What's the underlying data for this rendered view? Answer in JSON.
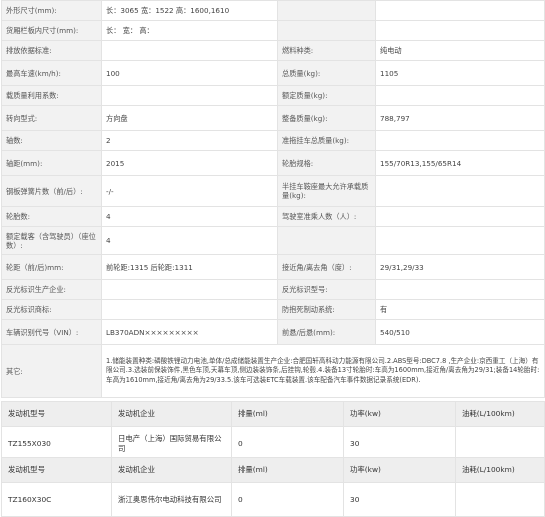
{
  "spec_rows": [
    {
      "k1": "外形尺寸(mm):",
      "v1": "长：3065 宽：1522 高：1600,1610",
      "k2": "",
      "v2": ""
    },
    {
      "k1": "货厢栏板内尺寸(mm):",
      "v1": "长：    宽：    高：",
      "k2": "",
      "v2": ""
    },
    {
      "k1": "排放依据标准:",
      "v1": "",
      "k2": "燃料种类:",
      "v2": "纯电动"
    },
    {
      "k1": "最高车速(km/h):",
      "v1": "100",
      "k2": "总质量(kg):",
      "v2": "1105"
    },
    {
      "k1": "载质量利用系数:",
      "v1": "",
      "k2": "额定质量(kg):",
      "v2": ""
    },
    {
      "k1": "转向型式:",
      "v1": "方向盘",
      "k2": "整备质量(kg):",
      "v2": "788,797"
    },
    {
      "k1": "轴数:",
      "v1": "2",
      "k2": "准拖挂车总质量(kg):",
      "v2": ""
    },
    {
      "k1": "轴距(mm):",
      "v1": "2015",
      "k2": "轮胎规格:",
      "v2": "155/70R13,155/65R14"
    },
    {
      "k1": "钢板弹簧片数（前/后）:",
      "v1": "-/-",
      "k2": "半挂车鞍座最大允许承载质量(kg):",
      "v2": ""
    },
    {
      "k1": "轮胎数:",
      "v1": "4",
      "k2": "驾驶室准乘人数（人）:",
      "v2": ""
    },
    {
      "k1": "额定载客（含驾驶员）（座位数）:",
      "v1": "4",
      "k2": "",
      "v2": ""
    },
    {
      "k1": "轮距（前/后)mm:",
      "v1": "前轮距:1315 后轮距:1311",
      "k2": "接近角/离去角（度）:",
      "v2": "29/31,29/33"
    },
    {
      "k1": "反光标识生产企业:",
      "v1": "",
      "k2": "反光标识型号:",
      "v2": ""
    },
    {
      "k1": "反光标识商标:",
      "v1": "",
      "k2": "防抱死制动系统:",
      "v2": "有"
    },
    {
      "k1": "车辆识别代号（VIN）:",
      "v1": "LB370ADN×××××××××",
      "k2": "前悬/后悬(mm):",
      "v2": "540/510"
    }
  ],
  "other": {
    "label": "其它:",
    "text": "1.储能装置种类:磷酸铁锂动力电池,单体/总成储能装置生产企业:合肥国轩高科动力能源有限公司.2.ABS型号:DBC7.8 ,生产企业:京西重工（上海）有限公司.3.选装前保装饰件,黑色车顶,天幕车顶,侧边装装饰条,后挂钩,轮毂.4.装备13寸轮胎时:车高为1600mm,接近角/离去角为29/31;装备14轮胎时:车高为1610mm,接近角/离去角为29/33.5.该车可选装ETC车载装置.该车配备汽车事件数据记录系统(EDR)."
  },
  "engine_tables": [
    {
      "headers": {
        "model": "发动机型号",
        "maker": "发动机企业",
        "displacement": "排量(ml)",
        "power": "功率(kw)",
        "fuel": "油耗(L/100km)"
      },
      "row": {
        "model": "TZ155X030",
        "maker": "日电产（上海）国际贸易有限公司",
        "displacement": "0",
        "power": "30",
        "fuel": ""
      }
    },
    {
      "headers": {
        "model": "发动机型号",
        "maker": "发动机企业",
        "displacement": "排量(ml)",
        "power": "功率(kw)",
        "fuel": "油耗(L/100km)"
      },
      "row": {
        "model": "TZ160X30C",
        "maker": "浙江奥思伟尔电动科技有限公司",
        "displacement": "0",
        "power": "30",
        "fuel": ""
      }
    }
  ]
}
